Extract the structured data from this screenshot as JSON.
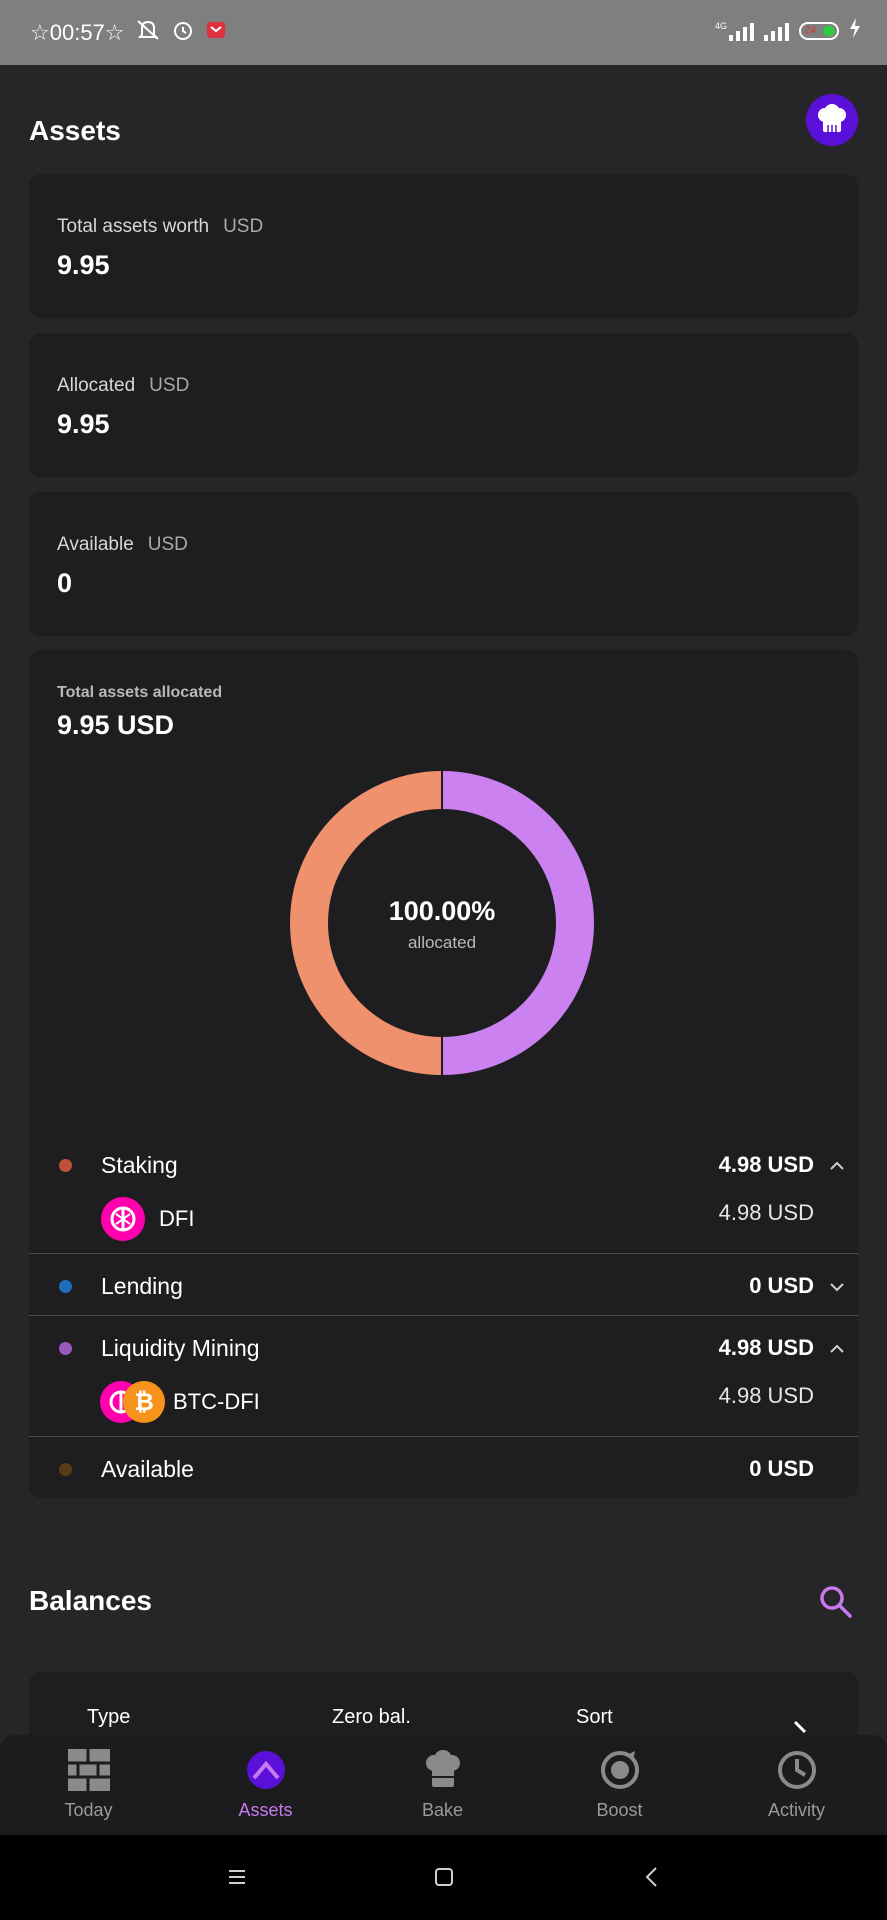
{
  "status_bar": {
    "time": "00:57",
    "network": "4G",
    "battery": "24"
  },
  "header": {
    "title": "Assets"
  },
  "cards": [
    {
      "label": "Total assets worth",
      "unit": "USD",
      "value": "9.95"
    },
    {
      "label": "Allocated",
      "unit": "USD",
      "value": "9.95"
    },
    {
      "label": "Available",
      "unit": "USD",
      "value": "0"
    }
  ],
  "allocation": {
    "title": "Total assets allocated",
    "total": "9.95 USD",
    "center_percent": "100.00%",
    "center_label": "allocated",
    "rows": [
      {
        "name": "Staking",
        "amount": "4.98 USD",
        "color": "#c0503a",
        "expanded": true,
        "token": {
          "name": "DFI",
          "amount": "4.98 USD"
        }
      },
      {
        "name": "Lending",
        "amount": "0 USD",
        "color": "#1a6fb8",
        "expanded": false
      },
      {
        "name": "Liquidity Mining",
        "amount": "4.98 USD",
        "color": "#9b59c0",
        "expanded": true,
        "token": {
          "name": "BTC-DFI",
          "amount": "4.98 USD"
        }
      },
      {
        "name": "Available",
        "amount": "0 USD",
        "color": "#5c3b14",
        "expanded": false
      }
    ]
  },
  "chart_data": {
    "type": "pie",
    "categories": [
      "Staking",
      "Liquidity Mining"
    ],
    "values": [
      4.98,
      4.98
    ],
    "colors": [
      "#f0916e",
      "#cb82f0"
    ]
  },
  "balances": {
    "title": "Balances",
    "filters": [
      "Type",
      "Zero bal.",
      "Sort"
    ]
  },
  "tabs": [
    {
      "label": "Today",
      "icon": "today-icon"
    },
    {
      "label": "Assets",
      "icon": "assets-icon",
      "active": true
    },
    {
      "label": "Bake",
      "icon": "bake-icon"
    },
    {
      "label": "Boost",
      "icon": "boost-icon"
    },
    {
      "label": "Activity",
      "icon": "activity-icon"
    }
  ]
}
